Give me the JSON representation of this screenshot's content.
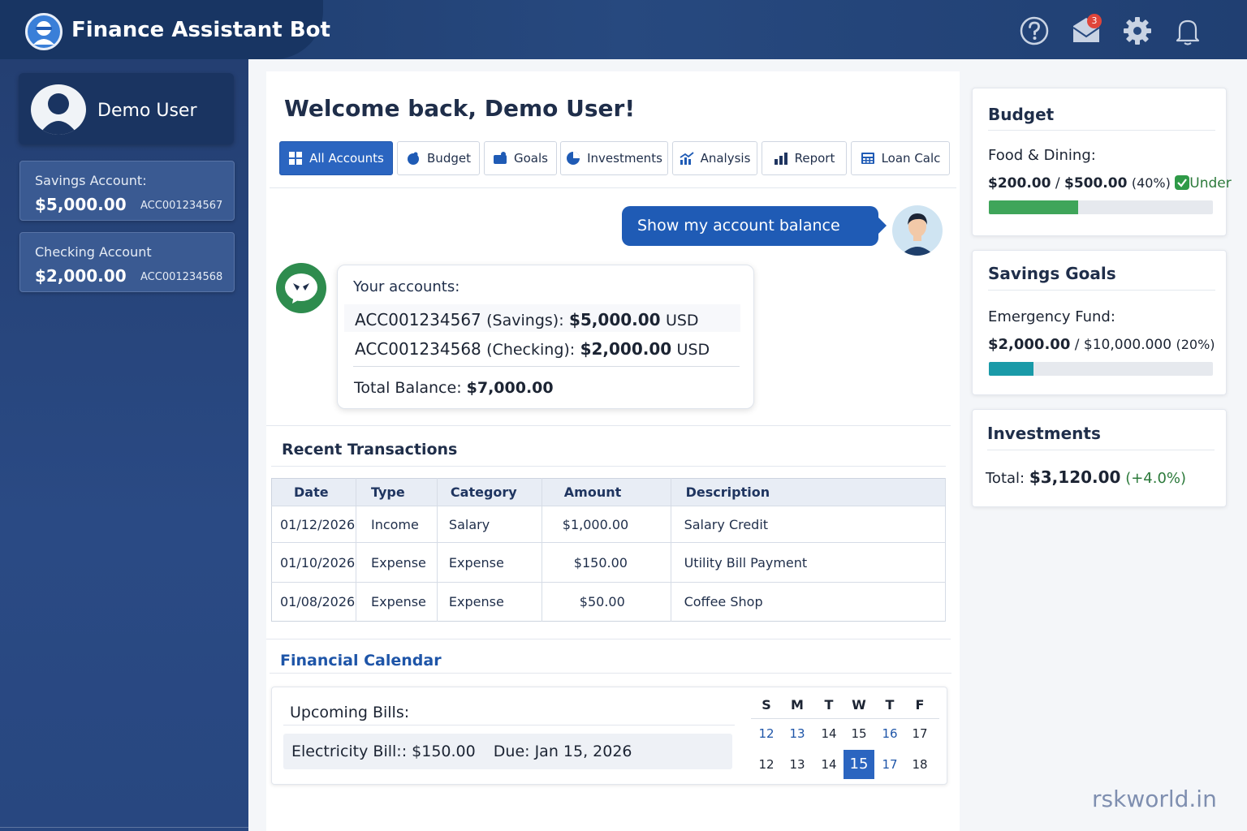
{
  "app": {
    "title": "Finance Assistant Bot",
    "unread_mail": "3"
  },
  "icons": {
    "help": "help-icon",
    "mail": "mail-icon",
    "settings": "gear-icon",
    "notifications": "bell-icon"
  },
  "colors": {
    "header": "#1d3a6b",
    "sidebar": "#243f72",
    "accent": "#2b65c0",
    "budget_bar": "#3fa55a",
    "goal_bar": "#1a9aa8",
    "positive": "#2c7a3b"
  },
  "sidebar": {
    "user_name": "Demo User",
    "accounts": [
      {
        "type": "Savings Account:",
        "balance": "$5,000.00",
        "number": "ACC001234567"
      },
      {
        "type": "Checking Account",
        "balance": "$2,000.00",
        "number": "ACC001234568"
      }
    ]
  },
  "main": {
    "welcome": "Welcome back, Demo User!",
    "tabs": [
      {
        "label": "All Accounts",
        "icon": "grid-icon"
      },
      {
        "label": "Budget",
        "icon": "piggy-bank-icon"
      },
      {
        "label": "Goals",
        "icon": "wallet-icon"
      },
      {
        "label": "Investments",
        "icon": "pie-chart-icon"
      },
      {
        "label": "Analysis",
        "icon": "analytics-icon"
      },
      {
        "label": "Report",
        "icon": "bar-chart-icon"
      },
      {
        "label": "Loan Calc",
        "icon": "calculator-icon"
      }
    ]
  },
  "chat": {
    "user_message": "Show my account balance",
    "bot_heading": "Your accounts:",
    "bot_rows": [
      {
        "acct": "ACC001234567",
        "kind": "(Savings):",
        "amount": "$5,000.00",
        "currency": "USD"
      },
      {
        "acct": "ACC001234568",
        "kind": "(Checking):",
        "amount": "$2,000.00",
        "currency": "USD"
      }
    ],
    "total_label": "Total Balance:",
    "total_value": "$7,000.00"
  },
  "transactions": {
    "title": "Recent Transactions",
    "columns": [
      "Date",
      "Type",
      "Category",
      "Amount",
      "Description"
    ],
    "rows": [
      {
        "date": "01/12/2026",
        "type": "Income",
        "category": "Salary",
        "amount": "$1,000.00",
        "description": "Salary Credit"
      },
      {
        "date": "01/10/2026",
        "type": "Expense",
        "category": "Expense",
        "amount": "$150.00",
        "description": "Utility Bill Payment"
      },
      {
        "date": "01/08/2026",
        "type": "Expense",
        "category": "Expense",
        "amount": "$50.00",
        "description": "Coffee Shop"
      }
    ]
  },
  "calendar": {
    "title": "Financial Calendar",
    "bills_title": "Upcoming Bills:",
    "bill": {
      "name": "Electricity Bill::",
      "amount": "$150.00",
      "due": "Due: Jan 15, 2026"
    },
    "weekdays": [
      "S",
      "M",
      "T",
      "W",
      "T",
      "F"
    ],
    "week1": [
      "12",
      "13",
      "14",
      "15",
      "16",
      "17"
    ],
    "week2": [
      "12",
      "13",
      "14",
      "15",
      "17",
      "18"
    ],
    "selected": "15"
  },
  "budget": {
    "title": "Budget",
    "category": "Food & Dining:",
    "spent": "$200.00",
    "limit": "$500.00",
    "percent_label": "(40%)",
    "status": "Under",
    "progress": 0.4
  },
  "savings_goals": {
    "title": "Savings Goals",
    "goal": "Emergency Fund:",
    "saved": "$2,000.00",
    "target": "$10,000.000",
    "percent_label": "(20%)",
    "progress": 0.2
  },
  "investments": {
    "title": "Investments",
    "total_label": "Total:",
    "total_value": "$3,120.00",
    "change": "(+4.0%)"
  },
  "watermark": "rskworld.in"
}
